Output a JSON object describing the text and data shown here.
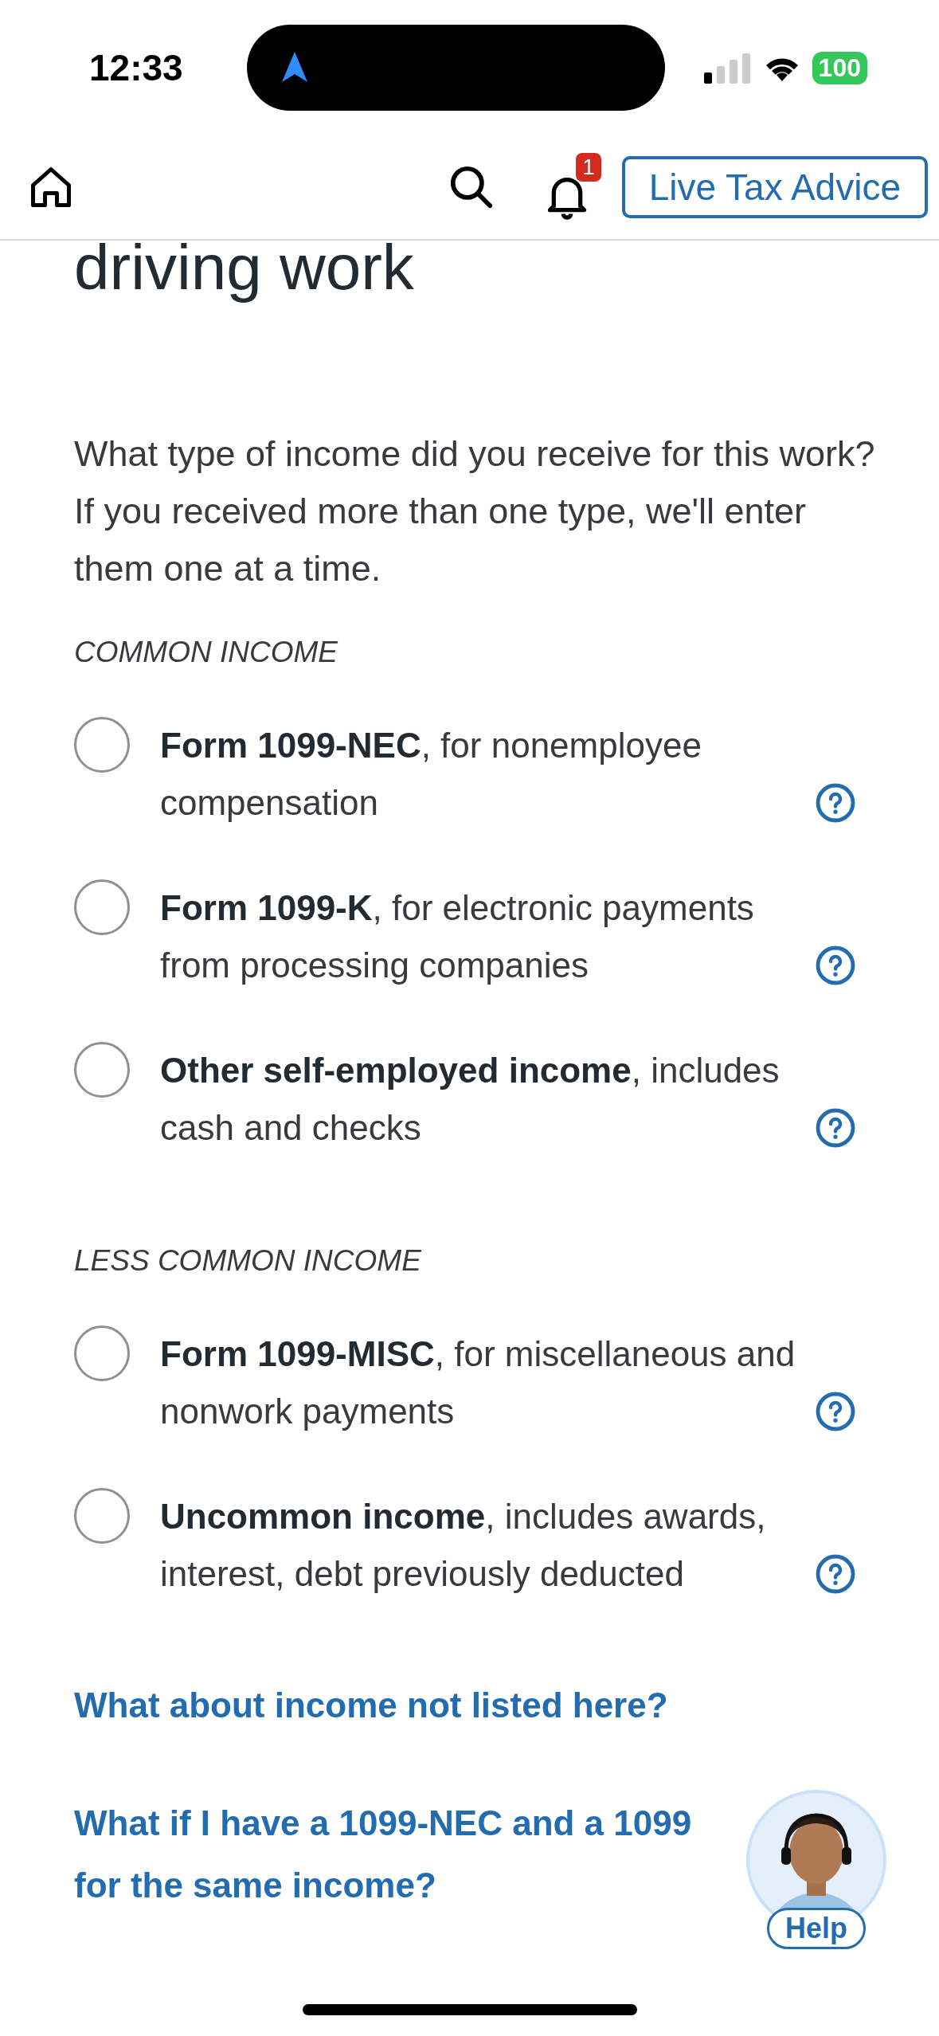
{
  "status_bar": {
    "time": "12:33",
    "battery": "100"
  },
  "nav": {
    "notification_count": "1",
    "advice_button": "Live Tax Advice"
  },
  "heading": "driving work",
  "question": "What type of income did you receive for this work? If you received more than one type, we'll enter them one at a time.",
  "groups": [
    {
      "title": "COMMON INCOME",
      "options": [
        {
          "label": "**Form 1099-NEC**, for nonemployee compensation",
          "selected": false
        },
        {
          "label": "**Form 1099-K**, for electronic payments from processing companies",
          "selected": false
        },
        {
          "label": "**Other self-employed income**, includes cash and checks",
          "selected": false
        }
      ]
    },
    {
      "title": "LESS COMMON INCOME",
      "options": [
        {
          "label": "**Form 1099-MISC**, for miscellaneous and nonwork payments",
          "selected": false
        },
        {
          "label": "**Uncommon income**, includes awards, interest, debt previously deducted",
          "selected": false
        }
      ]
    }
  ],
  "links": [
    "What about income not listed here?",
    "What if I have a 1099-NEC and a 1099\nfor the same income?"
  ],
  "help_button": "Help"
}
